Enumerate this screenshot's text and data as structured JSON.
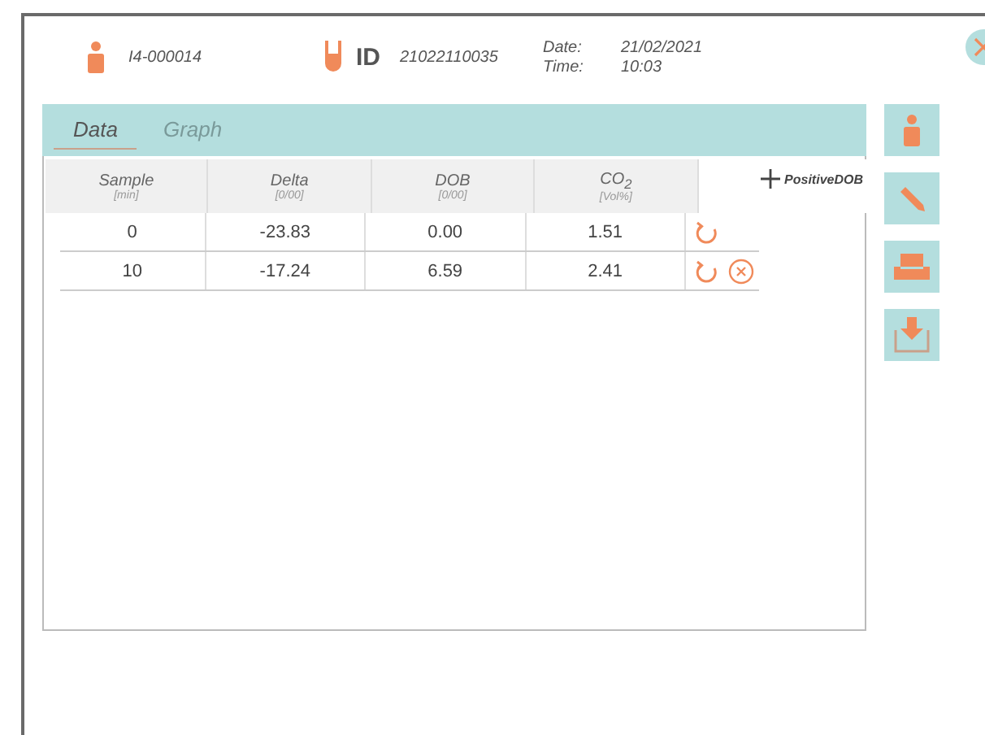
{
  "header": {
    "patient_id": "I4-000014",
    "id_label": "ID",
    "sample_id": "21022110035",
    "date_label": "Date:",
    "date": "21/02/2021",
    "time_label": "Time:",
    "time": "10:03"
  },
  "tabs": [
    {
      "label": "Data",
      "selected": true
    },
    {
      "label": "Graph",
      "selected": false
    }
  ],
  "table": {
    "columns": [
      {
        "title": "Sample",
        "unit": "[min]"
      },
      {
        "title": "Delta",
        "unit": "[0/00]"
      },
      {
        "title": "DOB",
        "unit": "[0/00]"
      },
      {
        "title": "CO$_{2}$",
        "unit": "[Vol%]"
      }
    ],
    "add_label": "PositiveDOB",
    "rows": [
      {
        "cells": [
          "0",
          "-23.83",
          "0.00",
          "1.51"
        ],
        "deletable": false
      },
      {
        "cells": [
          "10",
          "-17.24",
          "6.59",
          "2.41"
        ],
        "deletable": true
      }
    ]
  }
}
